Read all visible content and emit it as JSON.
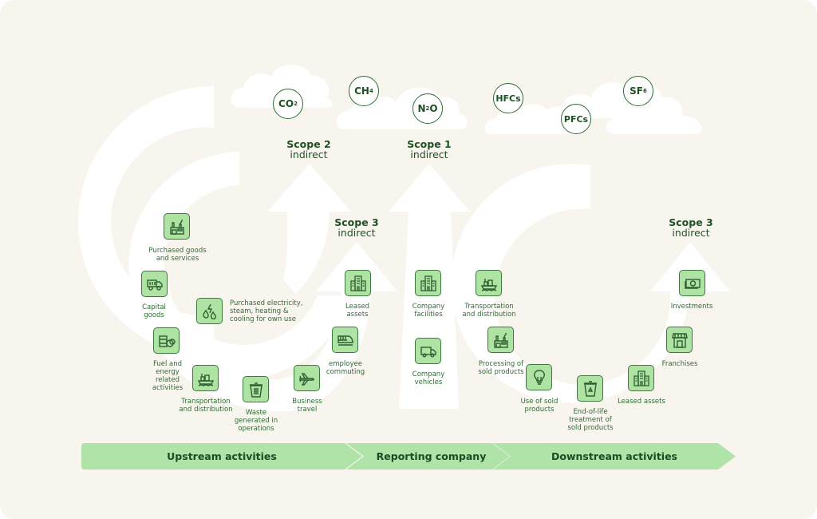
{
  "colors": {
    "background": "#f8f4ee",
    "arrows": "#ffffff",
    "icon_fill": "#aee3a4",
    "icon_border": "#3d7a3f",
    "text_dark": "#1e5224",
    "text_label": "#2e6d33",
    "band": "#b0e3a8"
  },
  "gases": [
    {
      "main": "CO",
      "sub": "2",
      "tail": ""
    },
    {
      "main": "CH",
      "sub": "4",
      "tail": ""
    },
    {
      "main": "N",
      "sub": "2",
      "tail": "O"
    },
    {
      "main": "HFCs",
      "sub": "",
      "tail": ""
    },
    {
      "main": "PFCs",
      "sub": "",
      "tail": ""
    },
    {
      "main": "SF",
      "sub": "6",
      "tail": ""
    }
  ],
  "scopes": {
    "scope2": {
      "title": "Scope 2",
      "subtitle": "indirect"
    },
    "scope1": {
      "title": "Scope 1",
      "subtitle": "indirect"
    },
    "scope3_upstream": {
      "title": "Scope 3",
      "subtitle": "indirect"
    },
    "scope3_downstream": {
      "title": "Scope 3",
      "subtitle": "indirect"
    }
  },
  "upstream": [
    {
      "label": "Purchased goods\nand services",
      "icon": "factory-icon"
    },
    {
      "label": "Capital\ngoods",
      "icon": "dump-truck-icon"
    },
    {
      "label": "Purchased electricity,\nsteam, heating &\ncooling for own use",
      "icon": "energy-drops-icon"
    },
    {
      "label": "Fuel and\nenergy\nrelated\nactivities",
      "icon": "fuel-barrels-icon"
    },
    {
      "label": "Transportation\nand distribution",
      "icon": "cargo-ship-icon"
    },
    {
      "label": "Waste\ngenerated in\noperations",
      "icon": "trash-bin-icon"
    },
    {
      "label": "Business\ntravel",
      "icon": "airplane-icon"
    },
    {
      "label": "employee\ncommuting",
      "icon": "train-icon"
    },
    {
      "label": "Leased\nassets",
      "icon": "office-building-icon"
    }
  ],
  "company": [
    {
      "label": "Company\nfacilities",
      "icon": "office-building-icon"
    },
    {
      "label": "Company\nvehicles",
      "icon": "delivery-truck-icon"
    }
  ],
  "downstream": [
    {
      "label": "Transportation\nand distribution",
      "icon": "cargo-ship-icon"
    },
    {
      "label": "Processing of\nsold products",
      "icon": "factory-icon"
    },
    {
      "label": "Use of sold\nproducts",
      "icon": "light-bulb-icon"
    },
    {
      "label": "End-of-life\ntreatment of\nsold products",
      "icon": "recycle-bin-icon"
    },
    {
      "label": "Leased assets",
      "icon": "office-building-icon"
    },
    {
      "label": "Franchises",
      "icon": "storefront-icon"
    },
    {
      "label": "Investments",
      "icon": "banknote-icon"
    }
  ],
  "bands": [
    {
      "label": "Upstream activities"
    },
    {
      "label": "Reporting company"
    },
    {
      "label": "Downstream activities"
    }
  ]
}
